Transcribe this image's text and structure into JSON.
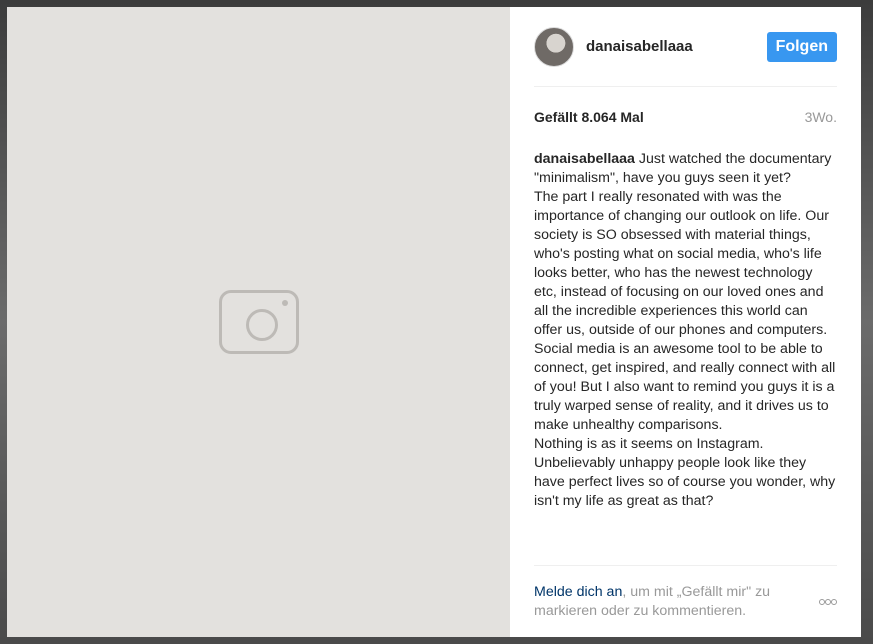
{
  "post": {
    "username": "danaisabellaaa",
    "follow_label": "Folgen",
    "likes": "Gefällt 8.064 Mal",
    "time": "3Wo.",
    "caption_user": "danaisabellaaa",
    "caption_text": " Just watched the documentary \"minimalism\", have you guys seen it yet?\nThe part I really resonated with was the importance of changing our outlook on life. Our society is SO obsessed with material things, who's posting what on social media, who's life looks better, who has the newest technology etc, instead of focusing on our loved ones and all the incredible experiences this world can offer us, outside of our phones and computers.\nSocial media is an awesome tool to be able to connect, get inspired, and really connect with all of you! But I also want to remind you guys it is a truly warped sense of reality, and it drives us to make unhealthy comparisons.\nNothing is as it seems on Instagram. Unbelievably unhappy people look like they have perfect lives so of course you wonder, why isn't my life as great as that?"
  },
  "footer": {
    "login_link": "Melde dich an",
    "login_rest": ", um mit „Gefällt mir\" zu markieren oder zu kommentieren."
  },
  "icons": {
    "more": "more-options-icon",
    "photo": "image-placeholder-icon"
  },
  "colors": {
    "follow_button": "#3897f0",
    "link": "#003569",
    "muted": "#999999"
  }
}
